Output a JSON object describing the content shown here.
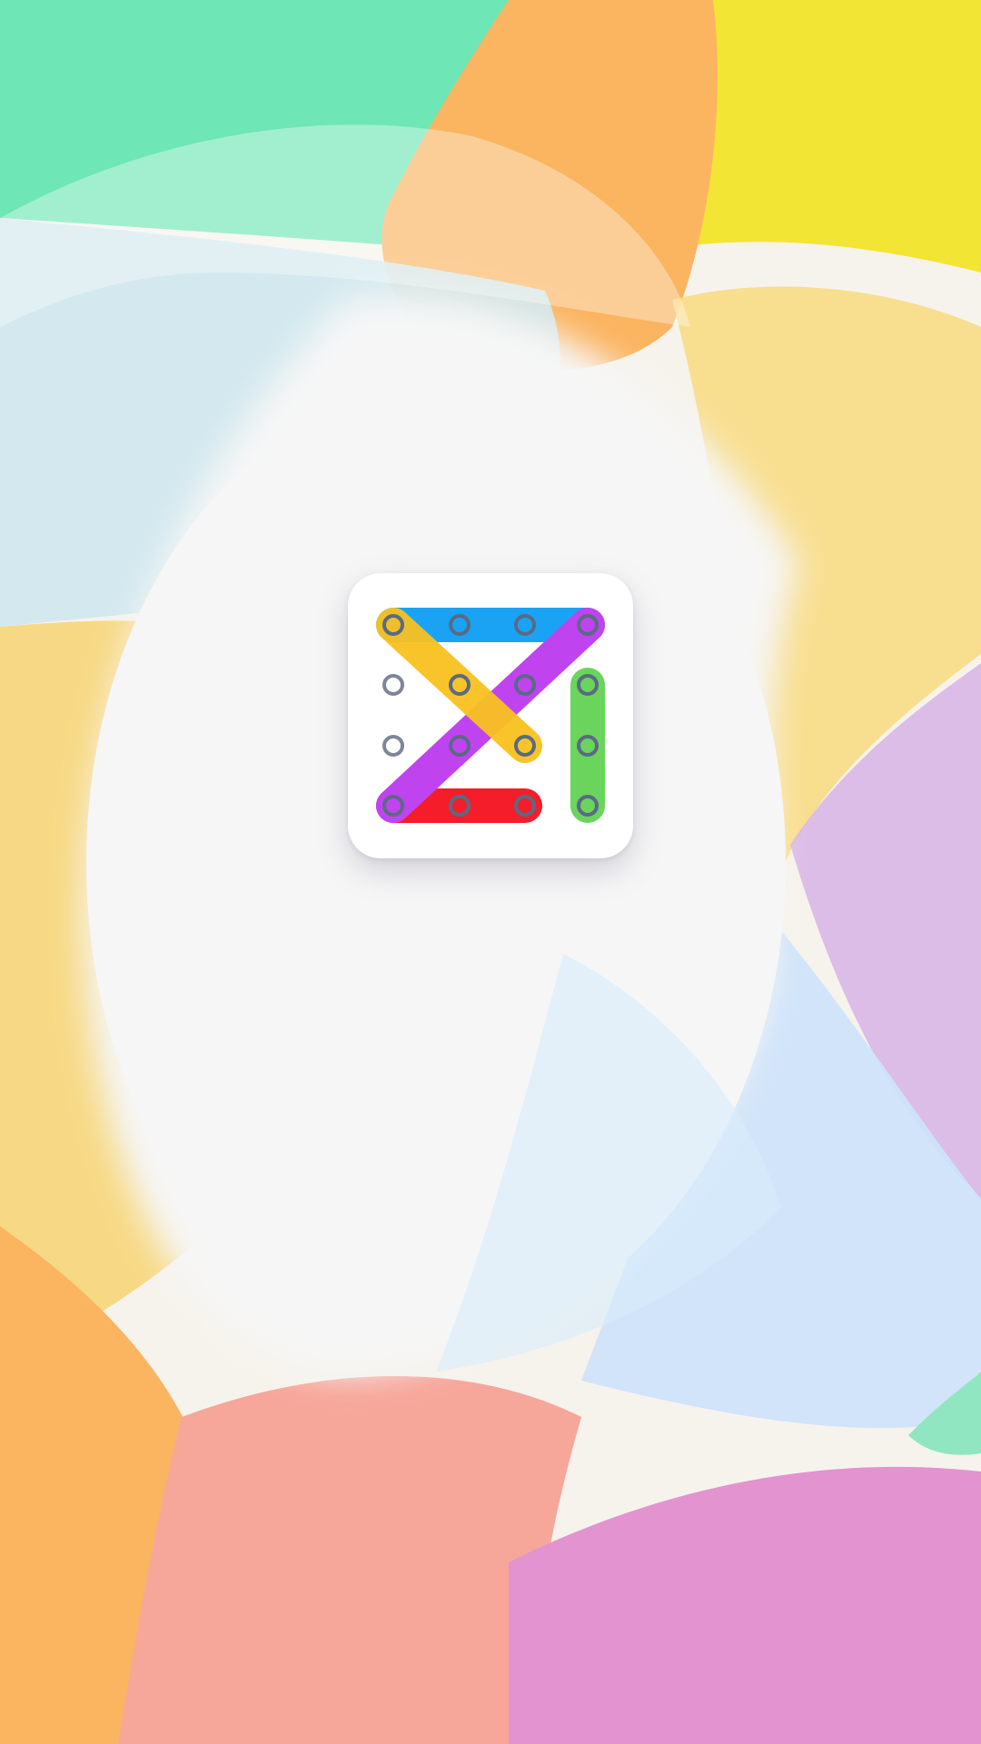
{
  "screen": "splash",
  "app_icon": {
    "icon": "word-search-grid-icon",
    "grid": {
      "rows": 4,
      "cols": 4
    },
    "highlights": [
      {
        "name": "top-row-highlight",
        "color": "#1aa3f5"
      },
      {
        "name": "anti-diagonal-highlight",
        "color": "#c043f0"
      },
      {
        "name": "main-diagonal-highlight",
        "color": "#f9c11f"
      },
      {
        "name": "right-column-highlight",
        "color": "#6ad45c"
      },
      {
        "name": "bottom-row-highlight",
        "color": "#f51d2a"
      }
    ],
    "ring_color": "#5a6a83"
  },
  "background_colors": [
    "#6fe6b5",
    "#f6e632",
    "#fbb45e",
    "#f7a69a",
    "#e393cf",
    "#cfe6fb",
    "#f5f5f5"
  ]
}
